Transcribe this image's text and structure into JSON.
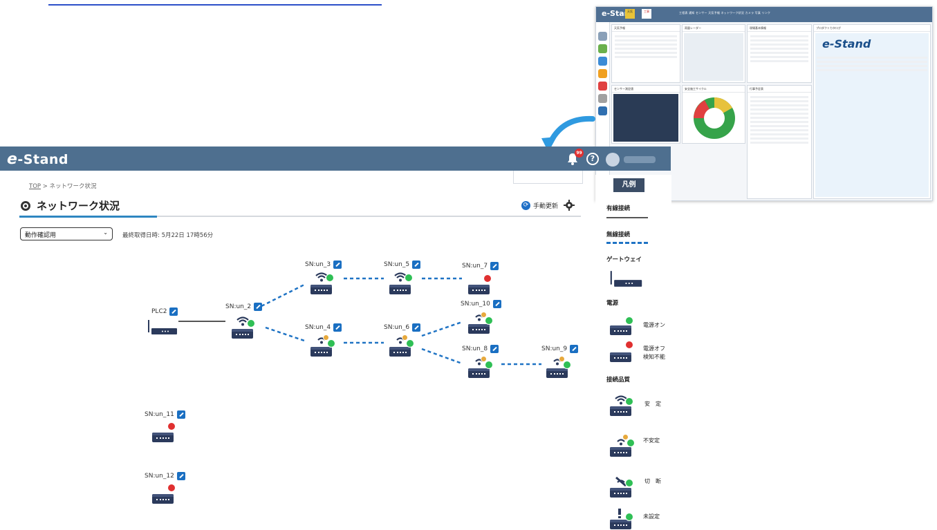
{
  "app": {
    "logo_text": "e-Stand",
    "logo_e": "e",
    "logo_rest": "-Stand"
  },
  "header": {
    "notification_count": "99",
    "help_label": "?"
  },
  "breadcrumb": {
    "top": "TOP",
    "separator": ">",
    "current": "ネットワーク状況"
  },
  "page": {
    "title": "ネットワーク状況",
    "manual_refresh": "手動更新"
  },
  "filter": {
    "selected": "動作確認用",
    "last_acquired": "最終取得日時: 5月22日 17時56分"
  },
  "nodes": [
    {
      "id": "plc2",
      "label": "PLC2",
      "type": "gateway"
    },
    {
      "id": "un_2",
      "label": "SN:un_2",
      "status": "on",
      "quality": "stable"
    },
    {
      "id": "un_3",
      "label": "SN:un_3",
      "status": "on",
      "quality": "stable"
    },
    {
      "id": "un_4",
      "label": "SN:un_4",
      "status": "on",
      "quality": "unstable"
    },
    {
      "id": "un_5",
      "label": "SN:un_5",
      "status": "on",
      "quality": "stable"
    },
    {
      "id": "un_6",
      "label": "SN:un_6",
      "status": "on",
      "quality": "unstable"
    },
    {
      "id": "un_7",
      "label": "SN:un_7",
      "status": "off",
      "quality": "none"
    },
    {
      "id": "un_8",
      "label": "SN:un_8",
      "status": "on",
      "quality": "unstable"
    },
    {
      "id": "un_9",
      "label": "SN:un_9",
      "status": "on",
      "quality": "unstable"
    },
    {
      "id": "un_10",
      "label": "SN:un_10",
      "status": "on",
      "quality": "unstable"
    },
    {
      "id": "un_11",
      "label": "SN:un_11",
      "status": "off",
      "quality": "none"
    },
    {
      "id": "un_12",
      "label": "SN:un_12",
      "status": "off",
      "quality": "none"
    }
  ],
  "legend": {
    "title": "凡例",
    "wired": "有線接続",
    "wireless": "無線接続",
    "gateway": "ゲートウェイ",
    "power": "電源",
    "power_on": "電源オン",
    "power_off_1": "電源オフ",
    "power_off_2": "検知不能",
    "quality": "接続品質",
    "stable": "安　定",
    "unstable": "不安定",
    "disconnected": "切　断",
    "unset": "未設定"
  },
  "colors": {
    "header": "#4e6f8f",
    "accent": "#2e86c1",
    "on": "#2fbf55",
    "off": "#e03030",
    "warn": "#e7a93c",
    "device": "#2b3a5c"
  },
  "inset": {
    "logo": "e-Stand",
    "nav": "工程表 通知 センサー 天気予報 ネットワーク状況 カメラ 写真 リンク",
    "cards": [
      "天気予報",
      "雨量レーダー",
      "現場基本情報",
      "センサー測定値",
      "安全施工サイクル",
      "行事予定表",
      "e-Stand"
    ]
  }
}
